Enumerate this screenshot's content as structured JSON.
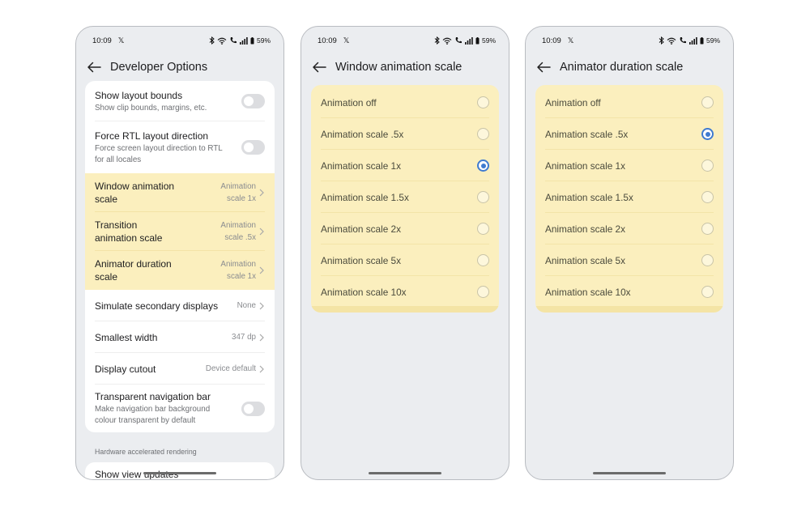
{
  "status": {
    "time": "10:09",
    "battery": "59%"
  },
  "screen1": {
    "title": "Developer Options",
    "rows": [
      {
        "label": "Show layout bounds",
        "sub": "Show clip bounds, margins, etc."
      },
      {
        "label": "Force RTL layout direction",
        "sub": "Force screen layout direction to RTL for all locales"
      },
      {
        "label": "Window animation scale",
        "value": "Animation scale 1x"
      },
      {
        "label": "Transition animation scale",
        "value": "Animation scale .5x"
      },
      {
        "label": "Animator duration scale",
        "value": "Animation scale 1x"
      },
      {
        "label": "Simulate secondary displays",
        "value": "None"
      },
      {
        "label": "Smallest width",
        "value": "347 dp"
      },
      {
        "label": "Display cutout",
        "value": "Device default"
      },
      {
        "label": "Transparent navigation bar",
        "sub": "Make navigation bar background colour transparent by default"
      }
    ],
    "section": "Hardware accelerated rendering",
    "peek_row": "Show view updates"
  },
  "screen2": {
    "title": "Window animation scale",
    "options": [
      "Animation off",
      "Animation scale .5x",
      "Animation scale 1x",
      "Animation scale 1.5x",
      "Animation scale 2x",
      "Animation scale 5x",
      "Animation scale 10x"
    ],
    "selected": "Animation scale 1x"
  },
  "screen3": {
    "title": "Animator duration scale",
    "options": [
      "Animation off",
      "Animation scale .5x",
      "Animation scale 1x",
      "Animation scale 1.5x",
      "Animation scale 2x",
      "Animation scale 5x",
      "Animation scale 10x"
    ],
    "selected": "Animation scale .5x"
  },
  "colors": {
    "highlight": "#fbefbe",
    "radio_selected": "#3f7bd0",
    "screen_bg": "#ebedf0"
  }
}
